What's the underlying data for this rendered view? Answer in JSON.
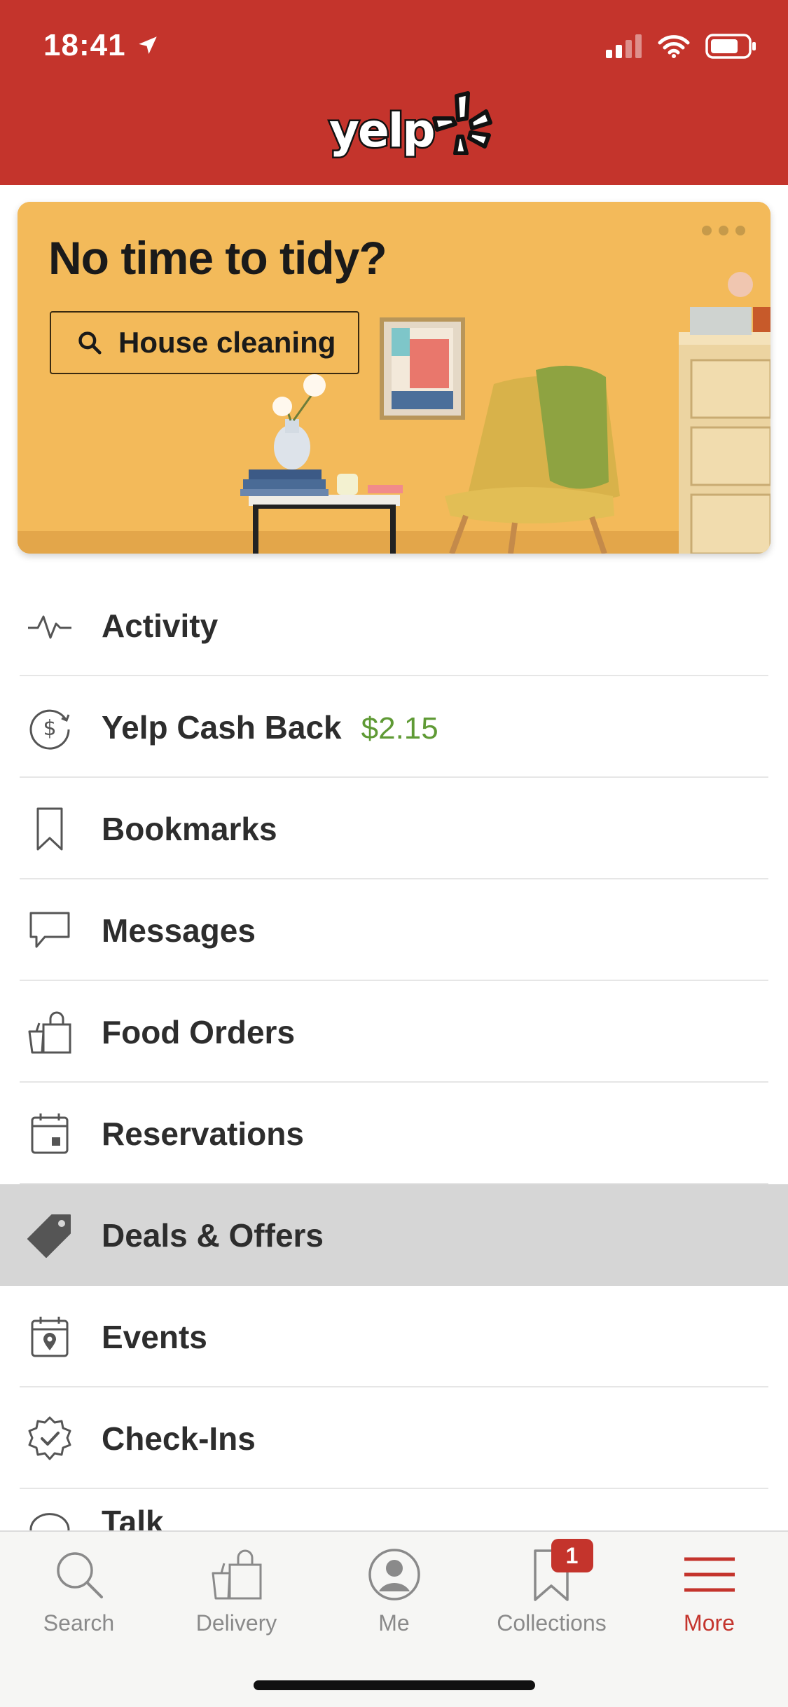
{
  "status_bar": {
    "time": "18:41"
  },
  "header": {
    "logo_text": "yelp",
    "brand_color": "#c4342c"
  },
  "promo": {
    "title": "No time to tidy?",
    "button_label": "House cleaning",
    "background_color": "#f4bd60"
  },
  "menu": {
    "items": [
      {
        "label": "Activity",
        "icon": "activity-icon"
      },
      {
        "label": "Yelp Cash Back",
        "value": "$2.15",
        "icon": "dollar-refresh-icon"
      },
      {
        "label": "Bookmarks",
        "icon": "bookmark-icon"
      },
      {
        "label": "Messages",
        "icon": "speech-bubble-icon"
      },
      {
        "label": "Food Orders",
        "icon": "shopping-bag-icon"
      },
      {
        "label": "Reservations",
        "icon": "calendar-icon"
      },
      {
        "label": "Deals & Offers",
        "icon": "tag-icon",
        "highlighted": true
      },
      {
        "label": "Events",
        "icon": "event-calendar-icon"
      },
      {
        "label": "Check-Ins",
        "icon": "check-badge-icon"
      },
      {
        "label": "Talk",
        "icon": "chat-icon"
      }
    ],
    "value_color": "#5f9a35",
    "highlight_color": "#d6d6d6"
  },
  "tabbar": {
    "tabs": [
      {
        "label": "Search",
        "icon": "search-icon"
      },
      {
        "label": "Delivery",
        "icon": "shopping-bag-icon"
      },
      {
        "label": "Me",
        "icon": "user-icon"
      },
      {
        "label": "Collections",
        "icon": "bookmark-icon",
        "badge": "1"
      },
      {
        "label": "More",
        "icon": "hamburger-icon",
        "active": true
      }
    ]
  }
}
